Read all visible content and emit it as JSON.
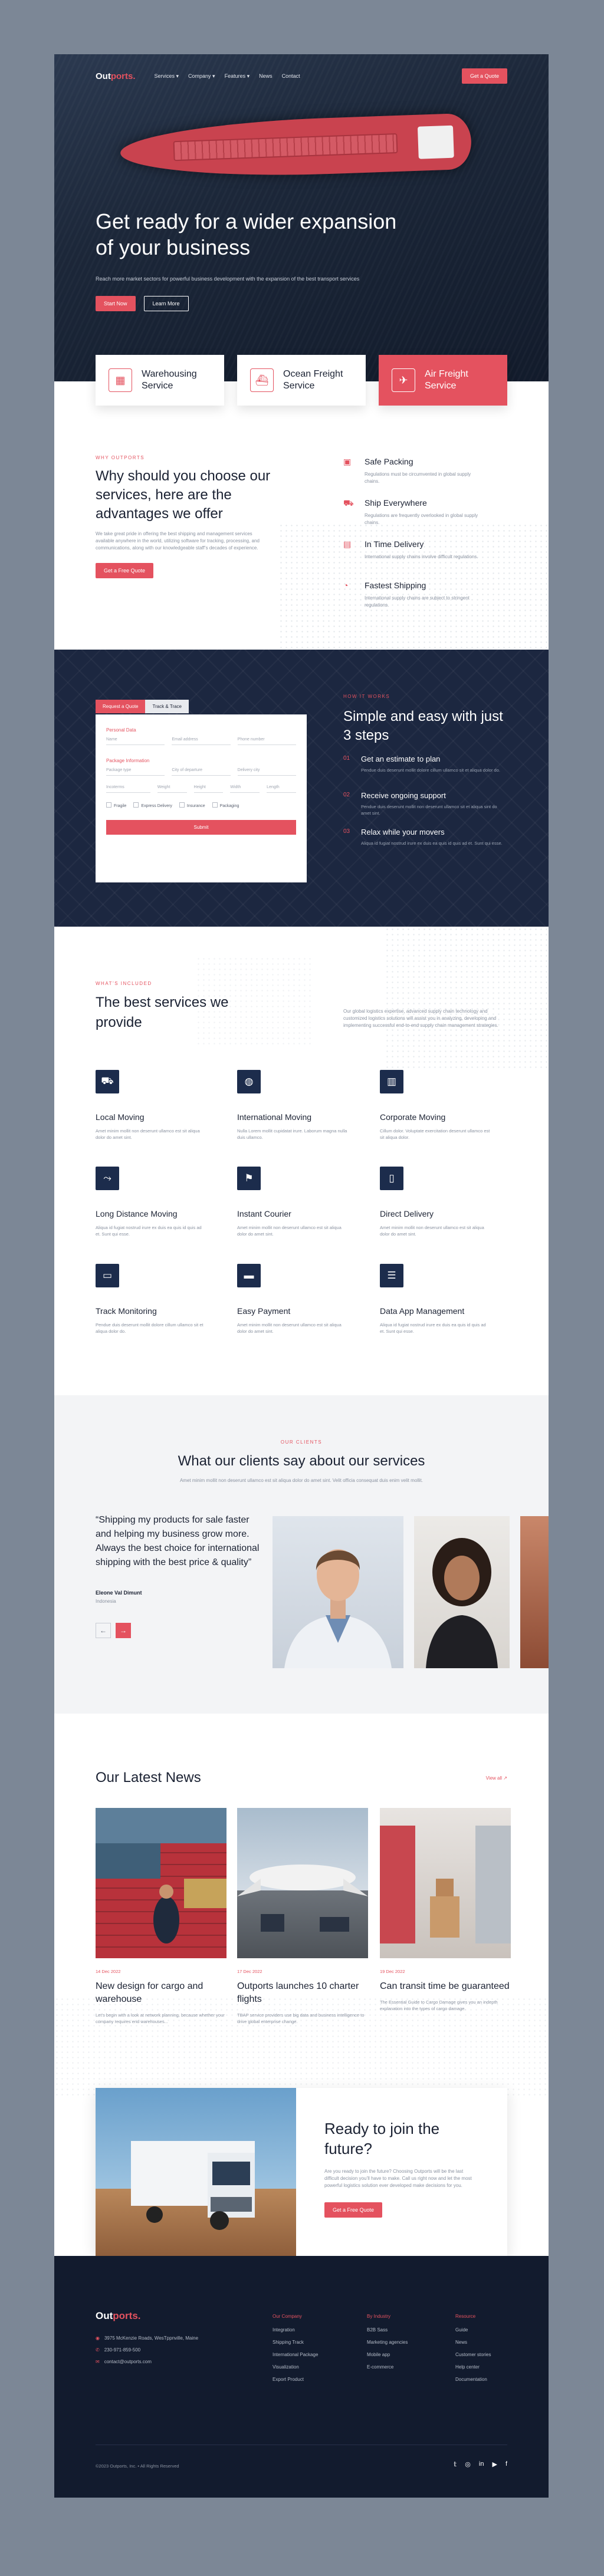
{
  "nav": {
    "logo_main": "Out",
    "logo_accent": "ports.",
    "links": [
      "Services ▾",
      "Company ▾",
      "Features ▾",
      "News",
      "Contact"
    ],
    "cta": "Get a Quote"
  },
  "hero": {
    "title": "Get ready for a wider expansion of your business",
    "subtitle": "Reach more market sectors for powerful business development with the expansion of the best transport services",
    "primary": "Start Now",
    "secondary": "Learn More"
  },
  "service_cards": [
    {
      "label": "Warehousing Service",
      "icon": "warehouse-icon"
    },
    {
      "label": "Ocean Freight Service",
      "icon": "ship-icon"
    },
    {
      "label": "Air Freight Service",
      "icon": "plane-icon"
    }
  ],
  "why": {
    "eyebrow": "WHY OUTPORTS",
    "title": "Why should you choose our services, here are the advantages we offer",
    "text": "We take great pride in offering the best shipping and management services available anywhere in the world, utilizing software for tracking, processing, and communications, along with our knowledgeable staff’s decades of experience.",
    "cta": "Get a Free Quote",
    "features": [
      {
        "title": "Safe Packing",
        "text": "Regulations must be circumvented in global supply chains.",
        "icon": "box-icon"
      },
      {
        "title": "Ship Everywhere",
        "text": "Regulations are frequently overlooked in global supply chains.",
        "icon": "truck-icon"
      },
      {
        "title": "In Time Delivery",
        "text": "International supply chains involve difficult regulations.",
        "icon": "calendar-icon"
      },
      {
        "title": "Fastest Shipping",
        "text": "International supply chains are subject to stringent regulations.",
        "icon": "dashboard-icon"
      }
    ]
  },
  "form": {
    "tabs": [
      "Request a Quote",
      "Track & Trace"
    ],
    "personal_label": "Personal Data",
    "personal_fields": [
      "Name",
      "Email address",
      "Phone number"
    ],
    "package_label": "Package Information",
    "package_row1": [
      "Package type",
      "City of departure",
      "Delivery city"
    ],
    "package_row2": [
      "Incoterms",
      "Weight",
      "Height",
      "Width",
      "Length"
    ],
    "checks": [
      "Fragile",
      "Express Delivery",
      "Insurance",
      "Packaging"
    ],
    "submit": "Submit"
  },
  "how": {
    "eyebrow": "HOW IT WORKS",
    "title": "Simple and easy with just 3 steps",
    "steps": [
      {
        "num": "01",
        "title": "Get an estimate to plan",
        "text": "Pendue duis deserunt mollit dolore cillum ullamco sit et aliqua dolor do."
      },
      {
        "num": "02",
        "title": "Receive ongoing support",
        "text": "Pendue duis deserunt mollit non deserunt ullamco sit et aliqua sint do amet sint."
      },
      {
        "num": "03",
        "title": "Relax while your movers",
        "text": "Aliqua id fugiat nostrud irure ex duis ea quis id quis ad et. Sunt qui esse."
      }
    ]
  },
  "services": {
    "eyebrow": "WHAT’S INCLUDED",
    "title": "The best services we provide",
    "intro": "Our global logistics expertise, advanced supply chain technology and customized logistics solutions will assist you in analyzing, developing and implementing successful end-to-end supply chain management strategies.",
    "items": [
      {
        "title": "Local Moving",
        "text": "Amet minim mollit non deserunt ullamco est sit aliqua dolor do amet sint.",
        "icon": "truck-icon"
      },
      {
        "title": "International Moving",
        "text": "Nulla Lorem mollit cupidatat irure. Laborum magna nulla duis ullamco.",
        "icon": "globe-icon"
      },
      {
        "title": "Corporate Moving",
        "text": "Cillum dolor. Voluptate exercitation deserunt ullamco est sit aliqua dolor.",
        "icon": "building-icon"
      },
      {
        "title": "Long Distance Moving",
        "text": "Aliqua id fugiat nostrud irure ex duis ea quis id quis ad et. Sunt qui esse.",
        "icon": "route-icon"
      },
      {
        "title": "Instant Courier",
        "text": "Amet minim mollit non deserunt ullamco est sit aliqua dolor do amet sint.",
        "icon": "courier-icon"
      },
      {
        "title": "Direct Delivery",
        "text": "Amet minim mollit non deserunt ullamco est sit aliqua dolor do amet sint.",
        "icon": "door-icon"
      },
      {
        "title": "Track Monitoring",
        "text": "Pendue duis deserunt mollit dolore cillum ullamco sit et aliqua dolor do.",
        "icon": "monitor-icon"
      },
      {
        "title": "Easy Payment",
        "text": "Amet minim mollit non deserunt ullamco est sit aliqua dolor do amet sint.",
        "icon": "card-icon"
      },
      {
        "title": "Data App Management",
        "text": "Aliqua id fugiat nostrud irure ex duis ea quis id quis ad et. Sunt qui esse.",
        "icon": "server-icon"
      }
    ]
  },
  "testimonials": {
    "eyebrow": "OUR CLIENTS",
    "title": "What our clients say about our services",
    "subtitle": "Amet minim mollit non deserunt ullamco est sit aliqua dolor do amet sint. Velit officia consequat duis enim velit mollit.",
    "quote": "“Shipping my products for sale faster and helping my business grow more. Always the best choice for international shipping with the best price & quality”",
    "name": "Eleone Val Dimunt",
    "role": "Indonesia"
  },
  "news": {
    "title": "Our Latest News",
    "view_all": "View all ↗",
    "items": [
      {
        "date": "14 Dec 2022",
        "title": "New design for cargo and warehouse",
        "text": "Let’s begin with a look at network planning, because whether your company requires end warehouses..."
      },
      {
        "date": "17 Dec 2022",
        "title": "Outports launches 10 charter flights",
        "text": "TBAP service providers use big data and business intelligence to drive global enterprise change."
      },
      {
        "date": "19 Dec 2022",
        "title": "Can transit time be guaranteed",
        "text": "The Essential Guide to Cargo Damage gives you an indepth explanation into the types of cargo damage."
      }
    ]
  },
  "cta": {
    "title": "Ready to join the future?",
    "text": "Are you ready to join the future? Choosing Outports will be the last difficult decision you’ll have to make. Call us right now and let the most powerful logistics solution ever developed make decisions for you.",
    "button": "Get a Free Quote"
  },
  "footer": {
    "logo_main": "Out",
    "logo_accent": "ports.",
    "contact": [
      "3975 McKenzie Roads, WesTppnville, Maine",
      "230-971-859-500",
      "contact@outports.com"
    ],
    "columns": [
      {
        "title": "Our Company",
        "items": [
          "Integration",
          "Shipping Track",
          "International Package",
          "Visualization",
          "Export Product"
        ]
      },
      {
        "title": "By Industry",
        "items": [
          "B2B Sass",
          "Marketing agencies",
          "Mobile app",
          "E-commerce"
        ]
      },
      {
        "title": "Resource",
        "items": [
          "Guide",
          "News",
          "Customer stories",
          "Help center",
          "Documentation"
        ]
      }
    ],
    "copyright": "©2023 Outports, Inc. • All Rights Reserved",
    "social": [
      "twitter-icon",
      "instagram-icon",
      "linkedin-icon",
      "youtube-icon",
      "facebook-icon"
    ]
  },
  "colors": {
    "accent": "#e4525f",
    "navy": "#1c2740",
    "dark": "#121b2e"
  }
}
